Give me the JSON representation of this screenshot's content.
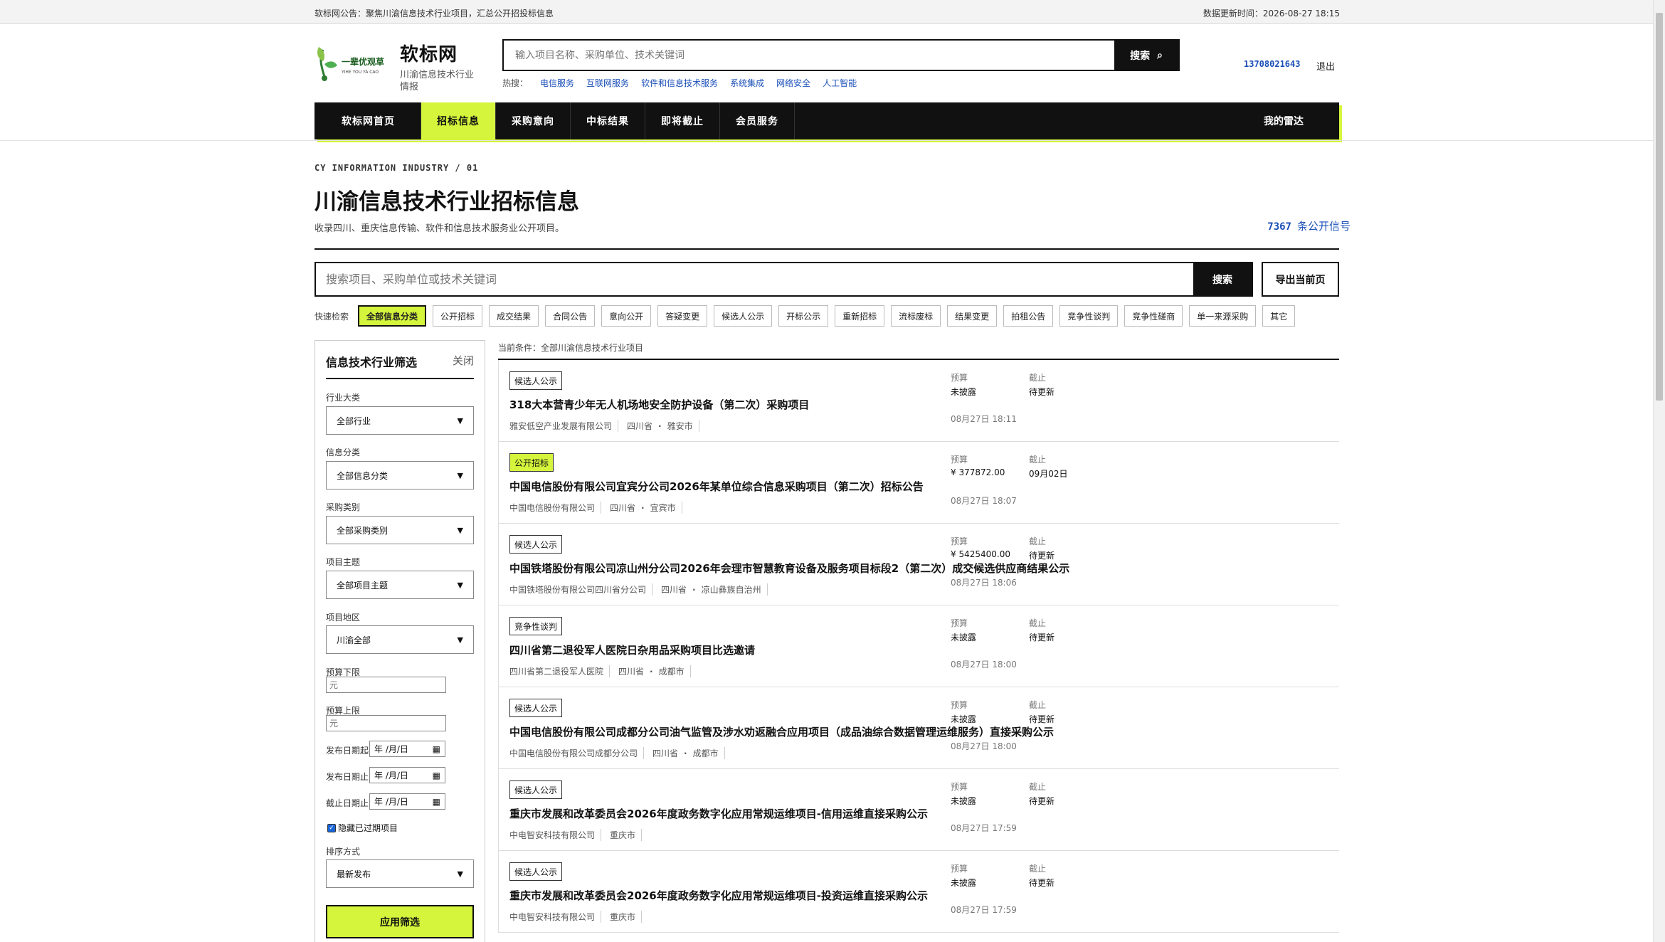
{
  "topbar": {
    "announcement": "软标网公告：聚焦川渝信息技术行业项目，汇总公开招投标信息",
    "updated": "数据更新时间：2026-08-27 18:15"
  },
  "brand": {
    "name": "软标网",
    "subtitle": "川渝信息技术行业情报",
    "logo_text": "一辈优观草",
    "logo_sub": "YIHE YOU YA CAO"
  },
  "header_search": {
    "placeholder": "输入项目名称、采购单位、技术关键词",
    "button": "搜索"
  },
  "hot": {
    "label": "热搜：",
    "items": [
      "电信服务",
      "互联网服务",
      "软件和信息技术服务",
      "系统集成",
      "网络安全",
      "人工智能"
    ]
  },
  "user": {
    "phone": "13708021643",
    "logout": "退出"
  },
  "nav": {
    "items": [
      "软标网首页",
      "招标信息",
      "采购意向",
      "中标结果",
      "即将截止",
      "会员服务"
    ],
    "active_index": 1,
    "right": "我的雷达"
  },
  "page": {
    "crumb": "CY INFORMATION INDUSTRY / 01",
    "title": "川渝信息技术行业招标信息",
    "desc": "收录四川、重庆信息传输、软件和信息技术服务业公开项目。",
    "count": "7367",
    "count_label": "条公开信号"
  },
  "main_search": {
    "placeholder": "搜索项目、采购单位或技术关键词",
    "button": "搜索",
    "export": "导出当前页"
  },
  "quick": {
    "label": "快速检索",
    "chips": [
      "全部信息分类",
      "公开招标",
      "成交结果",
      "合同公告",
      "意向公开",
      "答疑变更",
      "候选人公示",
      "开标公示",
      "重新招标",
      "流标废标",
      "结果变更",
      "拍租公告",
      "竞争性谈判",
      "竞争性磋商",
      "单一来源采购",
      "其它"
    ],
    "active_index": 0
  },
  "sidebar": {
    "title": "信息技术行业筛选",
    "close": "关闭",
    "industry_label": "行业大类",
    "industry_value": "全部行业",
    "category_label": "信息分类",
    "category_value": "全部信息分类",
    "purchase_label": "采购类别",
    "purchase_value": "全部采购类别",
    "subject_label": "项目主题",
    "subject_value": "全部项目主题",
    "region_label": "项目地区",
    "region_value": "川渝全部",
    "budget_min_label": "预算下限",
    "budget_min_ph": "元",
    "budget_max_label": "预算上限",
    "budget_max_ph": "元",
    "pub_from_label": "发布日期起",
    "pub_to_label": "发布日期止",
    "deadline_label": "截止日期止",
    "date_ph": "年 /月/日",
    "hide_expired": "隐藏已过期项目",
    "sort_label": "排序方式",
    "sort_value": "最新发布",
    "apply": "应用筛选"
  },
  "results": {
    "condition": "当前条件：全部川渝信息技术行业项目",
    "budget_label": "预算",
    "deadline_label": "截止",
    "items": [
      {
        "tag": "候选人公示",
        "green": false,
        "title": "318大本营青少年无人机场地安全防护设备（第二次）采购项目",
        "org": "雅安低空产业发展有限公司",
        "prov": "四川省",
        "city": "雅安市",
        "budget": "未披露",
        "deadline": "待更新",
        "date": "08月27日 18:11"
      },
      {
        "tag": "公开招标",
        "green": true,
        "title": "中国电信股份有限公司宜宾分公司2026年某单位综合信息采购项目（第二次）招标公告",
        "org": "中国电信股份有限公司",
        "prov": "四川省",
        "city": "宜宾市",
        "budget": "¥ 377872.00",
        "deadline": "09月02日",
        "date": "08月27日 18:07"
      },
      {
        "tag": "候选人公示",
        "green": false,
        "title": "中国铁塔股份有限公司凉山州分公司2026年会理市智慧教育设备及服务项目标段2（第二次）成交候选供应商结果公示",
        "org": "中国铁塔股份有限公司四川省分公司",
        "prov": "四川省",
        "city": "凉山彝族自治州",
        "budget": "¥ 5425400.00",
        "deadline": "待更新",
        "date": "08月27日 18:06"
      },
      {
        "tag": "竞争性谈判",
        "green": false,
        "title": "四川省第二退役军人医院日杂用品采购项目比选邀请",
        "org": "四川省第二退役军人医院",
        "prov": "四川省",
        "city": "成都市",
        "budget": "未披露",
        "deadline": "待更新",
        "date": "08月27日 18:00"
      },
      {
        "tag": "候选人公示",
        "green": false,
        "title": "中国电信股份有限公司成都分公司油气监管及涉水劝返融合应用项目（成品油综合数据管理运维服务）直接采购公示",
        "org": "中国电信股份有限公司成都分公司",
        "prov": "四川省",
        "city": "成都市",
        "budget": "未披露",
        "deadline": "待更新",
        "date": "08月27日 18:00"
      },
      {
        "tag": "候选人公示",
        "green": false,
        "title": "重庆市发展和改革委员会2026年度政务数字化应用常规运维项目-信用运维直接采购公示",
        "org": "中电智安科技有限公司",
        "prov": "",
        "city": "重庆市",
        "budget": "未披露",
        "deadline": "待更新",
        "date": "08月27日 17:59"
      },
      {
        "tag": "候选人公示",
        "green": false,
        "title": "重庆市发展和改革委员会2026年度政务数字化应用常规运维项目-投资运维直接采购公示",
        "org": "中电智安科技有限公司",
        "prov": "",
        "city": "重庆市",
        "budget": "未披露",
        "deadline": "待更新",
        "date": "08月27日 17:59"
      }
    ]
  },
  "colors": {
    "accent": "#d4f53c",
    "link": "#1a4fb8",
    "dark": "#111111"
  }
}
